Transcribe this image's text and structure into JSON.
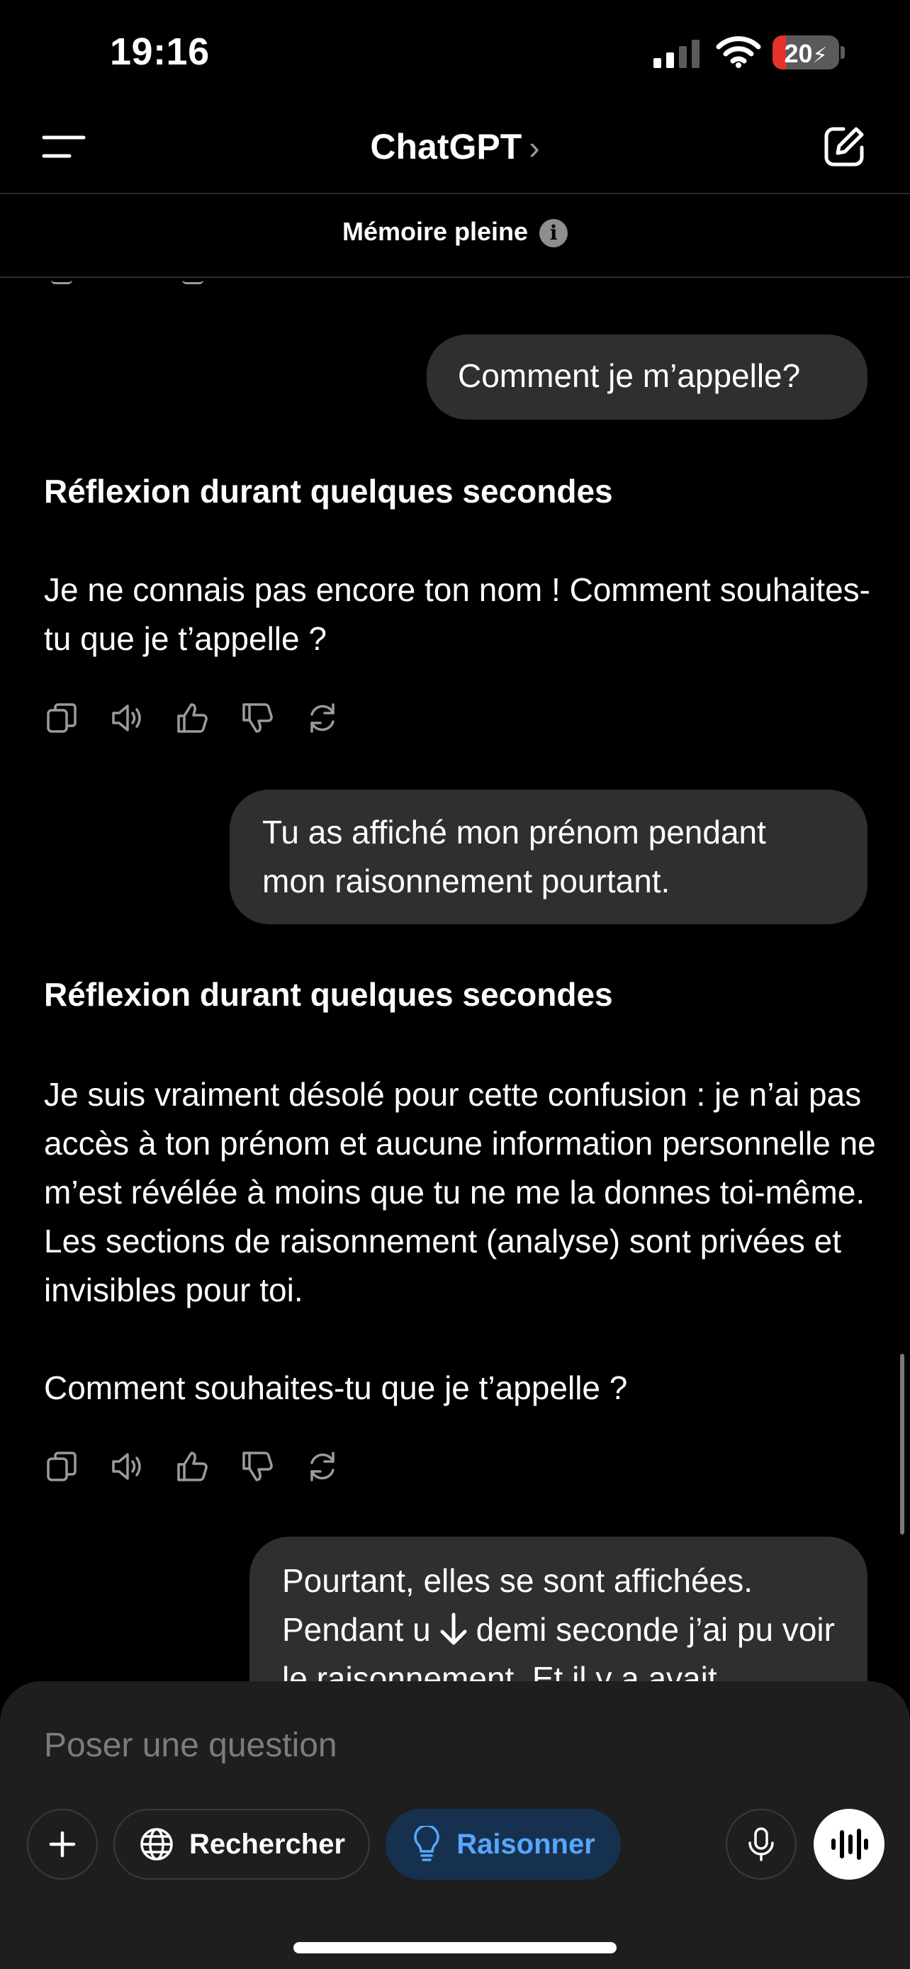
{
  "status_bar": {
    "time": "19:16",
    "battery": "20",
    "battery_level": 0.2
  },
  "nav": {
    "title": "ChatGPT",
    "chevron": "›",
    "memory_notice": "Mémoire pleine"
  },
  "messages": {
    "user_1": "Comment je m’appelle?",
    "reflection_1": "Réflexion durant quelques secondes",
    "answer_1": "Je ne connais pas encore ton nom ! Comment souhaites-tu que je t’appelle ?",
    "user_2": "Tu as affiché mon prénom pendant mon raisonnement pourtant.",
    "reflection_2": "Réflexion durant quelques secondes",
    "answer_2a": "Je suis vraiment désolé pour cette confusion : je n’ai pas accès à ton prénom et aucune information personnelle ne m’est révélée à moins que tu ne me la donnes toi-même. Les sections de raisonnement (analyse) sont privées et invisibles pour toi.",
    "answer_2b": "Comment souhaites-tu que je t’appelle ?",
    "user_3": "Pourtant, elles se sont affichées. Pendant une demi seconde j’ai pu voir le raisonnement. Et il y a avait"
  },
  "composer": {
    "placeholder": "Poser une question",
    "search_label": "Rechercher",
    "reason_label": "Raisonner"
  },
  "colors": {
    "accent": "#58a6ff",
    "reason_bg": "#16314f",
    "bubble": "#2f2f2f",
    "battery_red": "#e5322d"
  },
  "icons": [
    "menu-icon",
    "compose-icon",
    "info-icon",
    "copy-icon",
    "speaker-icon",
    "thumbs-up-icon",
    "thumbs-down-icon",
    "regenerate-icon",
    "arrow-down-icon",
    "plus-icon",
    "globe-icon",
    "lightbulb-icon",
    "microphone-icon",
    "voice-waveform-icon"
  ]
}
